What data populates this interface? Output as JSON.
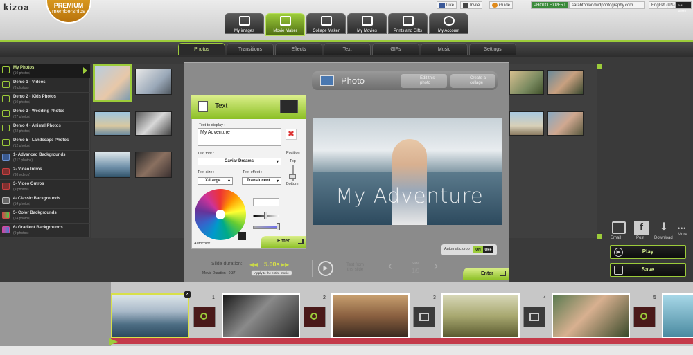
{
  "app": {
    "logo": "kizoa",
    "premium_line1": "PREMIUM",
    "premium_line2": "memberships"
  },
  "toplinks": {
    "like": "Like",
    "invite": "Invite",
    "guide": "Guide",
    "expert": "PHOTO EXPERT",
    "email": "sarahthplandwdphotography.com",
    "lang": "English (US)",
    "fs": "Full screen"
  },
  "main_tabs": [
    "My images",
    "Movie Maker",
    "Collage Maker",
    "My Movies",
    "Prints and Gifts",
    "My Account"
  ],
  "sub_tabs": [
    "Photos",
    "Transitions",
    "Effects",
    "Text",
    "GIFs",
    "Music",
    "Settings"
  ],
  "sidebar": [
    {
      "name": "My Photos",
      "count": "(10 photos)"
    },
    {
      "name": "Demo 1 - Videos",
      "count": "(8 photos)"
    },
    {
      "name": "Demo 2 - Kids Photos",
      "count": "(10 photos)"
    },
    {
      "name": "Demo 3 - Wedding Photos",
      "count": "(27 photos)"
    },
    {
      "name": "Demo 4 - Animal Photos",
      "count": "(22 photos)"
    },
    {
      "name": "Demo 5 - Landscape Photos",
      "count": "(12 photos)"
    },
    {
      "name": "1- Advanced Backgrounds",
      "count": "(217 photos)"
    },
    {
      "name": "2- Video Intros",
      "count": "(38 videos)"
    },
    {
      "name": "3- Video Outros",
      "count": "(9 photos)"
    },
    {
      "name": "4- Classic Backgrounds",
      "count": "(14 photos)"
    },
    {
      "name": "5- Color Backgrounds",
      "count": "(14 photos)"
    },
    {
      "name": "6- Gradient Backgrounds",
      "count": "(9 photos)"
    }
  ],
  "photo_header": {
    "title": "Photo",
    "edit": "Edit this photo",
    "collage": "Create a collage"
  },
  "text_panel": {
    "title": "Text",
    "text_label": "Text to display :",
    "text_value": "My Adventure",
    "font_label": "Text font :",
    "font_value": "Caviar Dreams",
    "size_label": "Text size :",
    "size_value": "X-Large",
    "effect_label": "Text effect :",
    "effect_value": "Translucent",
    "position_label": "Position",
    "pos_top": "Top",
    "pos_bottom": "Bottom",
    "autocolor": "Autocolor",
    "enter": "Enter"
  },
  "preview": {
    "overlay_text": "My Adventure"
  },
  "slide_controls": {
    "duration_label": "Slide duration:",
    "duration_value": "5.00s",
    "movie_duration": "Movie Duration : 0:37",
    "apply_all": "Apply to the entire movie",
    "test_label": "Test from this slide",
    "slide_word": "Slide",
    "slide_pos": "1/9",
    "autocrop": "Automatic crop",
    "on": "ON",
    "off": "OFF",
    "enter": "Enter"
  },
  "right_actions": {
    "email": "Email",
    "post": "Post",
    "download": "Download",
    "more": "More",
    "play": "Play",
    "save": "Save"
  },
  "timeline": {
    "slides": [
      "1",
      "2",
      "3",
      "4",
      "5"
    ]
  },
  "colors": {
    "accent": "#9ccc3a",
    "premium": "#d08d1a",
    "timeline_bar": "#c43a4a"
  }
}
